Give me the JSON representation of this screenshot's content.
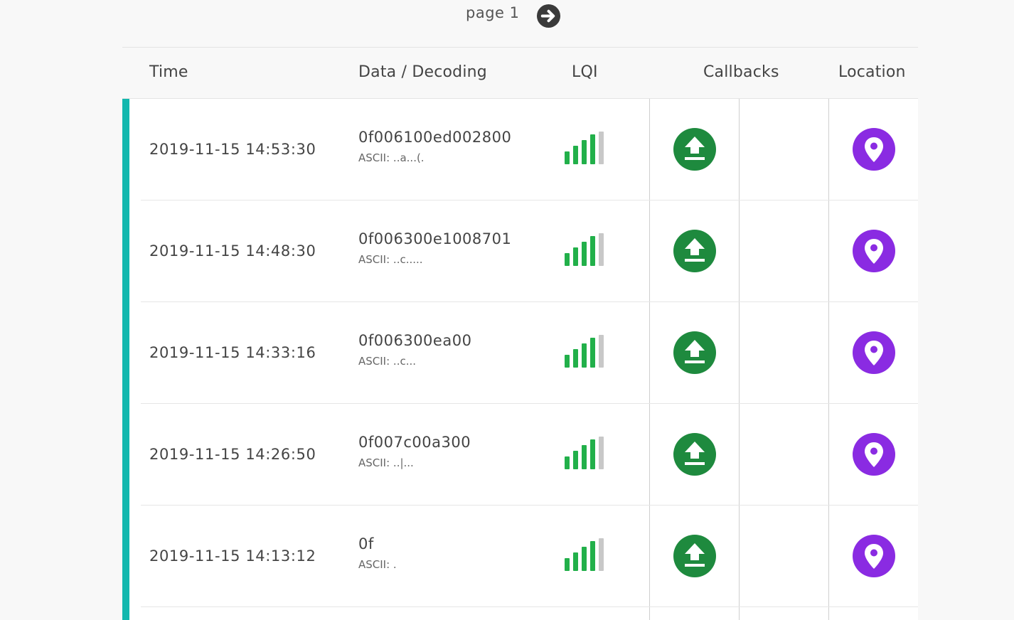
{
  "pager": {
    "label": "page 1",
    "next_icon": "arrow-right-circle-icon"
  },
  "table": {
    "headers": {
      "time": "Time",
      "data": "Data / Decoding",
      "lqi": "LQI",
      "callbacks": "Callbacks",
      "location": "Location"
    },
    "rows": [
      {
        "time": "2019-11-15 14:53:30",
        "hex": "0f006100ed002800",
        "ascii": "ASCII: ..a...(.",
        "lqi_bars": 4
      },
      {
        "time": "2019-11-15 14:48:30",
        "hex": "0f006300e1008701",
        "ascii": "ASCII: ..c.....",
        "lqi_bars": 4
      },
      {
        "time": "2019-11-15 14:33:16",
        "hex": "0f006300ea00",
        "ascii": "ASCII: ..c...",
        "lqi_bars": 4
      },
      {
        "time": "2019-11-15 14:26:50",
        "hex": "0f007c00a300",
        "ascii": "ASCII: ..|...",
        "lqi_bars": 4
      },
      {
        "time": "2019-11-15 14:13:12",
        "hex": "0f",
        "ascii": "ASCII: .",
        "lqi_bars": 4
      }
    ]
  },
  "icons": {
    "callback": "upload-arrow-icon",
    "location": "map-pin-icon",
    "lqi": "signal-bars-icon"
  },
  "colors": {
    "accent_bar": "#13b8ae",
    "callback_ok": "#1e8a3e",
    "location": "#8a2be2",
    "signal_on": "#22b04a",
    "signal_off": "#c8c8c8"
  }
}
